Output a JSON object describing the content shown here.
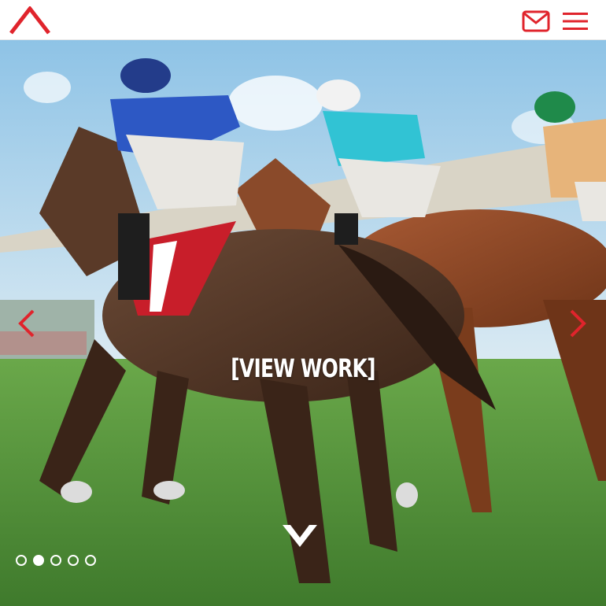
{
  "header": {
    "logo_icon": "brand-chevron-logo",
    "mail_icon": "envelope-icon",
    "menu_icon": "hamburger-menu-icon",
    "accent_color": "#e0242c"
  },
  "hero": {
    "cta_label": "[VIEW WORK]",
    "prev_icon": "chevron-left-icon",
    "next_icon": "chevron-right-icon",
    "scroll_icon": "chevron-down-icon",
    "slide_count": 5,
    "active_slide": 2,
    "image_subject": "horse-race-photo"
  }
}
